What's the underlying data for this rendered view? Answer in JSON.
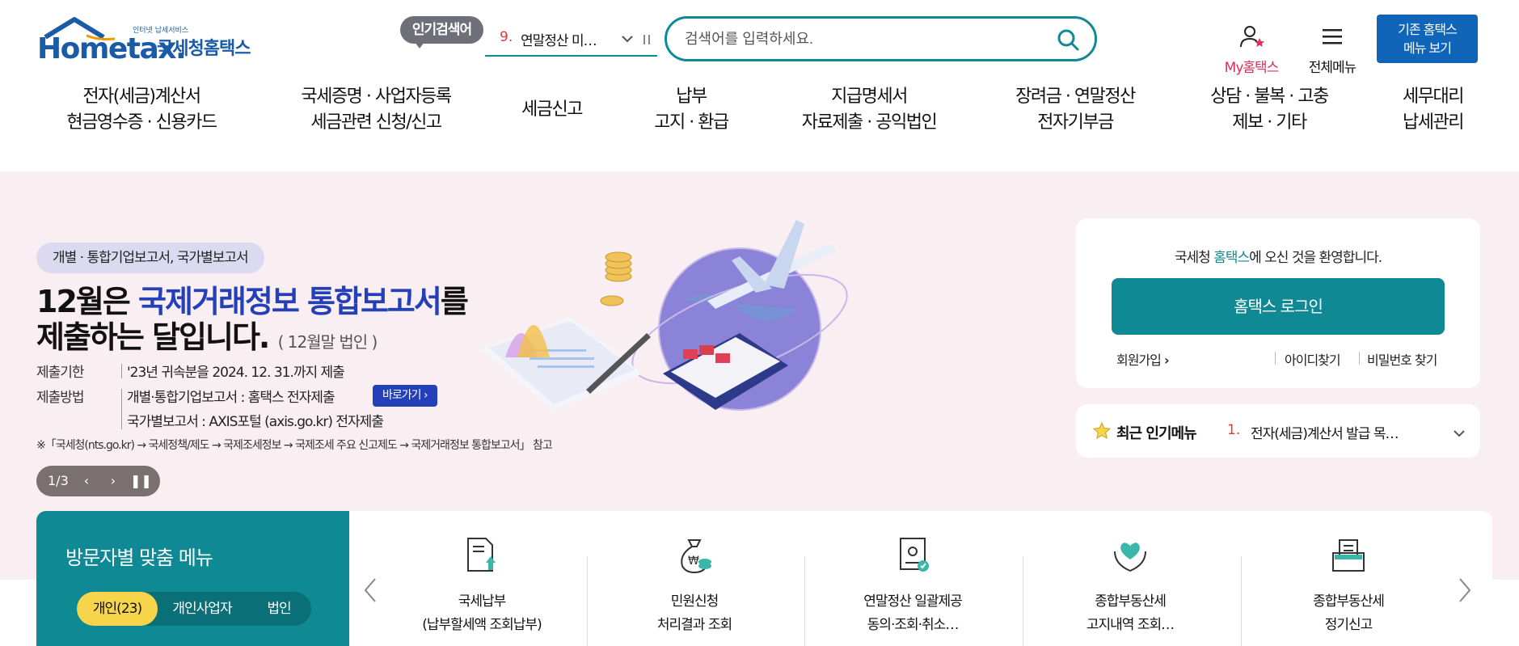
{
  "header": {
    "logo": {
      "small_text": "인터넷 납세서비스",
      "brand": "Hometax.",
      "brand_ko": "국세청홈택스"
    },
    "popular_search": {
      "badge": "인기검색어",
      "rank": "9.",
      "term": "연말정산 미…"
    },
    "search": {
      "placeholder": "검색어를 입력하세요."
    },
    "my_hometax": "My홈택스",
    "all_menu": "전체메뉴",
    "old_hometax": [
      "기존 홈택스",
      "메뉴 보기"
    ]
  },
  "gnb": [
    {
      "line1": "전자(세금)계산서",
      "line2": "현금영수증 · 신용카드"
    },
    {
      "line1": "국세증명 · 사업자등록",
      "line2": "세금관련 신청/신고"
    },
    {
      "line1": "세금신고",
      "line2": ""
    },
    {
      "line1": "납부",
      "line2": "고지 · 환급"
    },
    {
      "line1": "지급명세서",
      "line2": "자료제출 · 공익법인"
    },
    {
      "line1": "장려금 · 연말정산",
      "line2": "전자기부금"
    },
    {
      "line1": "상담 · 불복 · 고충",
      "line2": "제보 · 기타"
    },
    {
      "line1": "세무대리",
      "line2": "납세관리"
    }
  ],
  "hero": {
    "tag": "개별 · 통합기업보고서, 국가별보고서",
    "title1_a": "12월은 ",
    "title1_b": "국제거래정보 통합보고서",
    "title1_c": "를",
    "title2": "제출하는 달입니다.",
    "title2_note": "( 12월말 법인 )",
    "deadline_label": "제출기한",
    "deadline_value": "'23년 귀속분을 2024. 12. 31.까지 제출",
    "method_label": "제출방법",
    "method_value1": "개별·통합기업보고서 : 홈택스 전자제출",
    "goto_button": "바로가기",
    "method_value2": "국가별보고서 : AXIS포털 (axis.go.kr) 전자제출",
    "note": "※「국세청(nts.go.kr) → 국세정책/제도 → 국제조세정보 → 국제조세 주요 신고제도 → 국제거래정보 통합보고서」 참고",
    "slider_count": "1/3"
  },
  "login": {
    "welcome_a": "국세청 ",
    "welcome_hl": "홈택스",
    "welcome_b": "에 오신 것을 환영합니다.",
    "login_button": "홈택스 로그인",
    "signup": "회원가입",
    "find_id": "아이디찾기",
    "find_pw": "비밀번호 찾기"
  },
  "popular_menu": {
    "title": "최근 인기메뉴",
    "rank": "1.",
    "item": "전자(세금)계산서 발급 목…"
  },
  "visitor_menu": {
    "title": "방문자별 맞춤 메뉴",
    "tabs": [
      "개인(23)",
      "개인사업자",
      "법인"
    ],
    "active_tab": "개인(23)"
  },
  "quick_menu": [
    {
      "icon": "document-upload-icon",
      "line1": "국세납부",
      "line2": "(납부할세액 조회납부)"
    },
    {
      "icon": "money-bag-icon",
      "line1": "민원신청",
      "line2": "처리결과 조회"
    },
    {
      "icon": "certificate-icon",
      "line1": "연말정산 일괄제공",
      "line2": "동의·조회·취소…"
    },
    {
      "icon": "heart-hands-icon",
      "line1": "종합부동산세",
      "line2": "고지내역 조회…"
    },
    {
      "icon": "folder-document-icon",
      "line1": "종합부동산세",
      "line2": "정기신고"
    }
  ],
  "colors": {
    "brand_blue": "#1a5ba8",
    "teal": "#0f8a94",
    "hero_bg": "#f9eef1",
    "highlight_yellow": "#f7d54a",
    "accent_red": "#e03a3a"
  }
}
